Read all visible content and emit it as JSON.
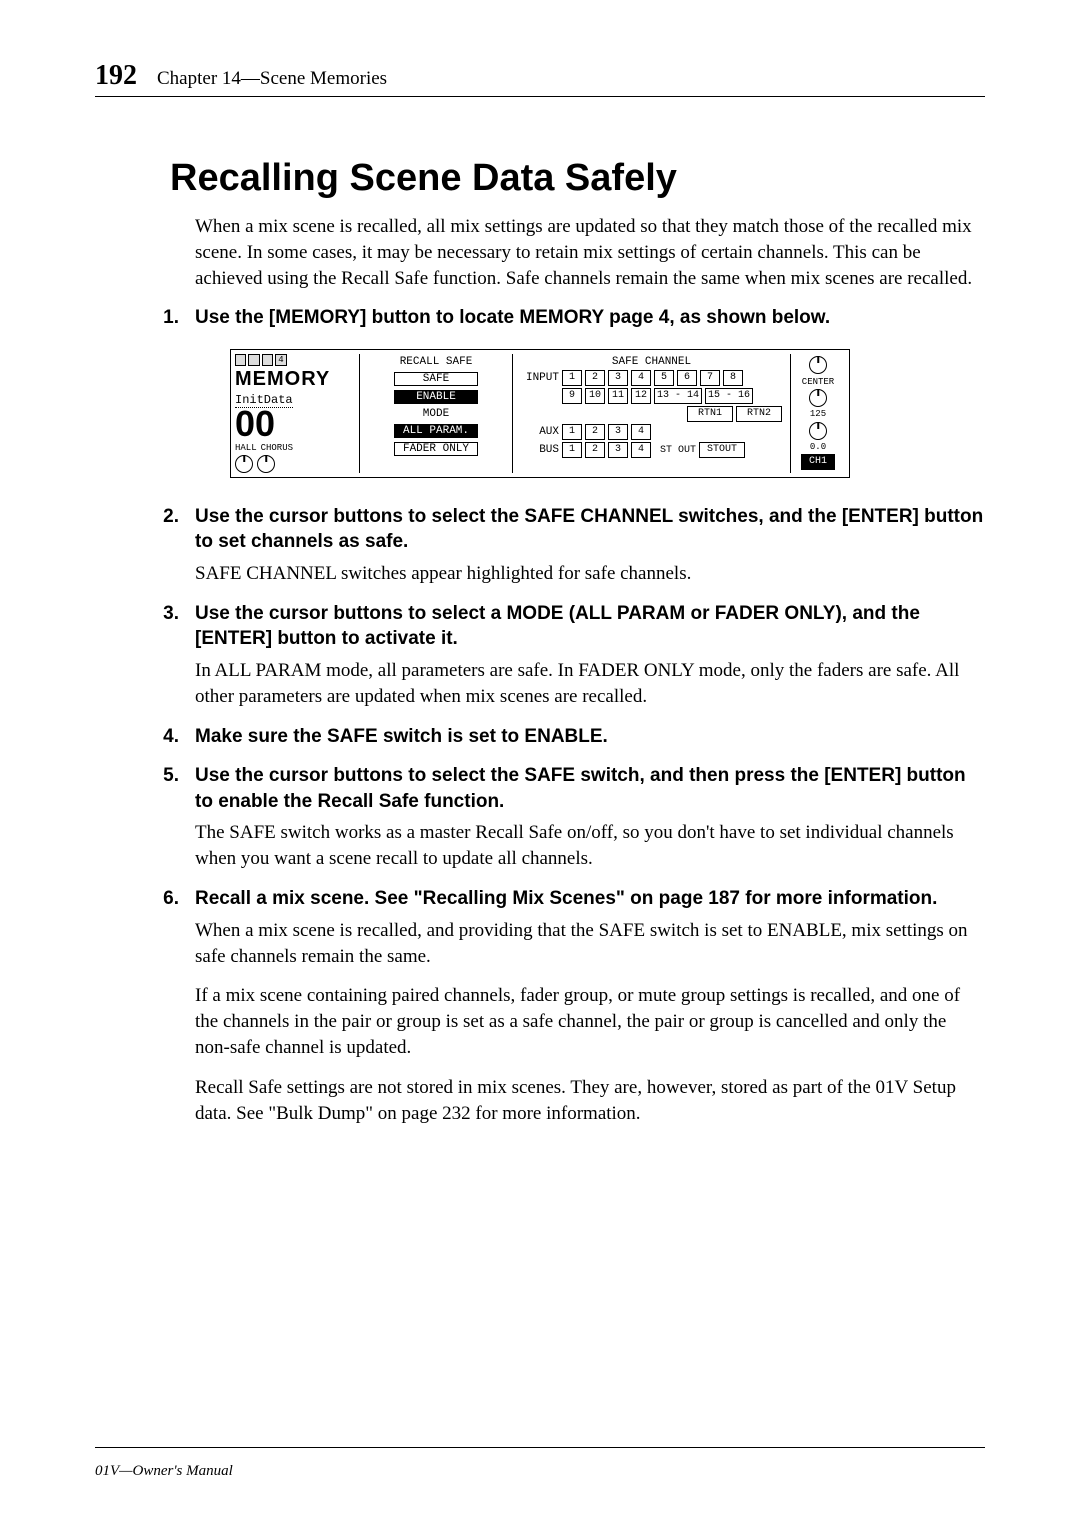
{
  "header": {
    "page_number": "192",
    "chapter_line": "Chapter 14—Scene Memories"
  },
  "heading": "Recalling Scene Data Safely",
  "intro": "When a mix scene is recalled, all mix settings are updated so that they match those of the recalled mix scene. In some cases, it may be necessary to retain mix settings of certain channels. This can be achieved using the Recall Safe function. Safe channels remain the same when mix scenes are recalled.",
  "steps": [
    {
      "n": "1.",
      "bold": "Use the [MEMORY] button to locate MEMORY page 4, as shown below.",
      "body": []
    },
    {
      "n": "2.",
      "bold": "Use the cursor buttons to select the SAFE CHANNEL switches, and the [ENTER] button to set channels as safe.",
      "body": [
        "SAFE CHANNEL switches appear highlighted for safe channels."
      ]
    },
    {
      "n": "3.",
      "bold": "Use the cursor buttons to select a MODE (ALL PARAM or FADER ONLY), and the [ENTER] button to activate it.",
      "body": [
        "In ALL PARAM mode, all parameters are safe. In FADER ONLY mode, only the faders are safe. All other parameters are updated when mix scenes are recalled."
      ]
    },
    {
      "n": "4.",
      "bold": "Make sure the SAFE switch is set to ENABLE.",
      "body": []
    },
    {
      "n": "5.",
      "bold": "Use the cursor buttons to select the SAFE switch, and then press the [ENTER] button to enable the Recall Safe function.",
      "body": [
        "The SAFE switch works as a master Recall Safe on/off, so you don't have to set individual channels when you want a scene recall to update all channels."
      ]
    },
    {
      "n": "6.",
      "bold": "Recall a mix scene. See \"Recalling Mix Scenes\" on page 187 for more information.",
      "body": [
        "When a mix scene is recalled, and providing that the SAFE switch is set to ENABLE, mix settings on safe channels remain the same.",
        "If a mix scene containing paired channels, fader group, or mute group settings is recalled, and one of the channels in the pair or group is set as a safe channel, the pair or group is cancelled and only the non-safe channel is updated.",
        "Recall Safe settings are not stored in mix scenes. They are, however, stored as part of the 01V Setup data. See \"Bulk Dump\" on page 232 for more information."
      ]
    }
  ],
  "lcd": {
    "tabs_suffix": "4",
    "memory_label": "MEMORY",
    "init_label": "InitData",
    "big_number": "00",
    "hall": "HALL",
    "chorus": "CHORUS",
    "mid": {
      "title": "RECALL SAFE",
      "safe": "SAFE",
      "enable": "ENABLE",
      "mode": "MODE",
      "all_param": "ALL PARAM.",
      "fader_only": "FADER ONLY"
    },
    "right": {
      "header": "SAFE CHANNEL",
      "input_lbl": "INPUT",
      "row1": [
        "1",
        "2",
        "3",
        "4",
        "5",
        "6",
        "7",
        "8"
      ],
      "row2": [
        "9",
        "10",
        "11",
        "12",
        "13 - 14",
        "15 - 16"
      ],
      "rtn1": "RTN1",
      "rtn2": "RTN2",
      "aux_lbl": "AUX",
      "aux": [
        "1",
        "2",
        "3",
        "4"
      ],
      "bus_lbl": "BUS",
      "bus": [
        "1",
        "2",
        "3",
        "4"
      ],
      "stout_lbl": "ST OUT",
      "stout": "STOUT"
    },
    "far": {
      "center": "CENTER",
      "num": "125",
      "val": "0.0",
      "ch": "CH1"
    }
  },
  "footer": "01V—Owner's Manual"
}
